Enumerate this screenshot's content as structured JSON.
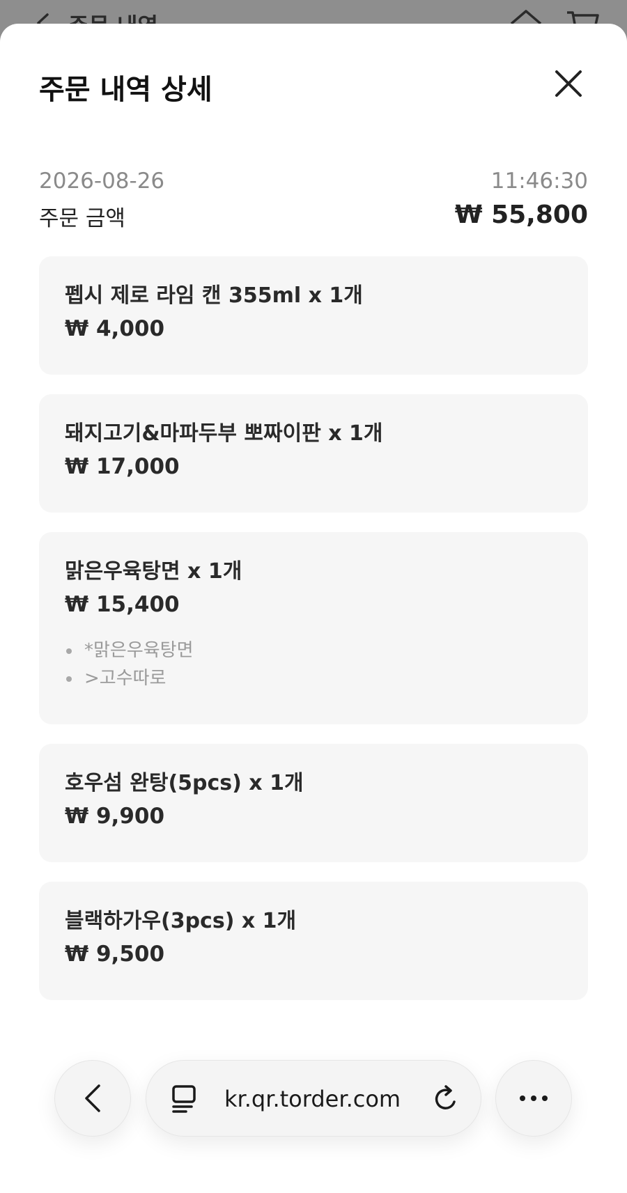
{
  "background_page": {
    "title": "주문 내역"
  },
  "sheet": {
    "title": "주문 내역 상세",
    "order": {
      "date": "2026-08-26",
      "time": "11:46:30",
      "amount_label": "주문 금액",
      "amount_value": "₩ 55,800"
    },
    "items": [
      {
        "name": "펩시 제로 라임 캔 355ml x 1개",
        "price": "₩ 4,000",
        "options": []
      },
      {
        "name": "돼지고기&마파두부 뽀짜이판 x 1개",
        "price": "₩ 17,000",
        "options": []
      },
      {
        "name": "맑은우육탕면 x 1개",
        "price": "₩ 15,400",
        "options": [
          "*맑은우육탕면",
          ">고수따로"
        ]
      },
      {
        "name": "호우섬 완탕(5pcs) x 1개",
        "price": "₩ 9,900",
        "options": []
      },
      {
        "name": "블랙하가우(3pcs) x 1개",
        "price": "₩ 9,500",
        "options": []
      }
    ]
  },
  "browser": {
    "url": "kr.qr.torder.com",
    "icons": {
      "back": "chevron-left-icon",
      "tabs": "tabs-icon",
      "reload": "reload-icon",
      "more": "more-horizontal-icon"
    }
  },
  "colors": {
    "card_bg": "#f6f6f6",
    "text_primary": "#222222",
    "text_muted": "#8a8a8a",
    "backdrop": "#8e8e8e"
  }
}
